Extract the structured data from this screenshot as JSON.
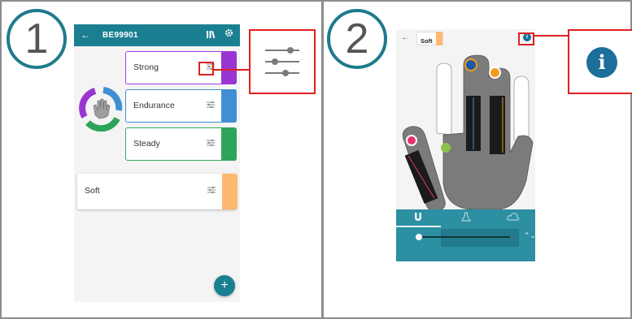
{
  "steps": {
    "one": "1",
    "two": "2"
  },
  "screen1": {
    "appbar": {
      "back": "←",
      "title": "BE99901",
      "library_icon": "library-icon",
      "settings_icon": "gear-icon"
    },
    "modes": [
      {
        "label": "Strong",
        "color": "#9b35d2"
      },
      {
        "label": "Endurance",
        "color": "#3f8fd2"
      },
      {
        "label": "Steady",
        "color": "#2ea35a"
      },
      {
        "label": "Soft",
        "color": "#ffb870"
      }
    ],
    "fab_label": "+"
  },
  "screen2": {
    "back": "←",
    "mode_label": "Soft",
    "mode_color": "#ffb870",
    "info_glyph": "i",
    "finger_dots": [
      "#e8336e",
      "#1a5aa8",
      "#f39a1e",
      "#8bc34a"
    ],
    "tabs": [
      "magnet-icon",
      "flask-icon",
      "cloud-icon"
    ],
    "stepper_glyph": "⌃⌄"
  },
  "colors": {
    "accent": "#1b7f92",
    "highlight": "#e02020"
  }
}
